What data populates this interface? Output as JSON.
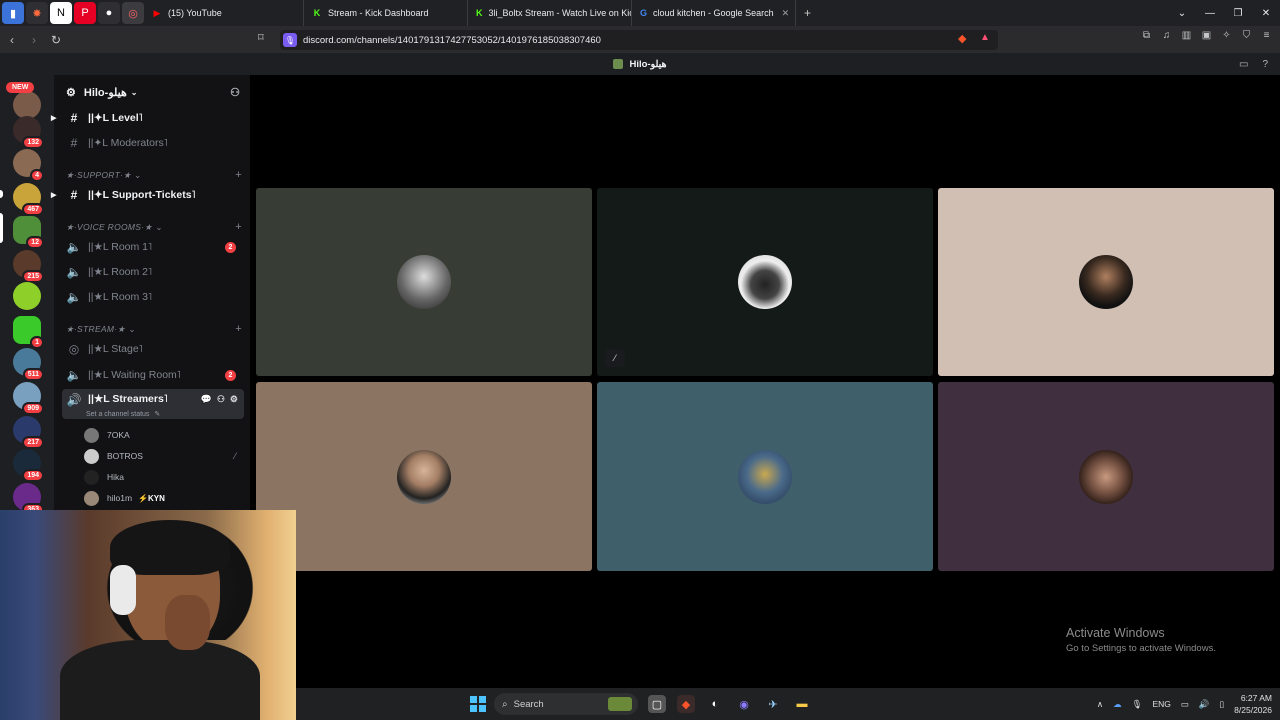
{
  "browser": {
    "tabs": [
      {
        "title": "(15) YouTube",
        "icon": "youtube-icon",
        "color": "#ff0000"
      },
      {
        "title": "Stream - Kick Dashboard",
        "icon": "kick-icon",
        "color": "#53fc18"
      },
      {
        "title": "3li_Boltx Stream - Watch Live on Kick",
        "icon": "kick-icon",
        "color": "#53fc18"
      },
      {
        "title": "cloud kitchen - Google Search",
        "icon": "google-icon",
        "color": "#4285f4"
      }
    ],
    "new_tab": "+",
    "url": "discord.com/channels/1401791317427753052/1401976185038307460"
  },
  "discord": {
    "title": "Hilo-هيلو",
    "server_name": "Hilo-هيلو",
    "new_label": "NEW",
    "server_badges": [
      "132",
      "4",
      "467",
      "12",
      "215",
      "1",
      "511",
      "909",
      "217",
      "194",
      "363"
    ],
    "channels": {
      "level": "||✦L Level˥",
      "moderators": "||✦L Moderators˥",
      "support_cat": "★·SUPPORT·★",
      "support_tickets": "||✦L Support-Tickets˥",
      "voice_cat": "★·VOICE ROOMS·★",
      "room1": "||★L Room 1˥",
      "room1_badge": "2",
      "room2": "||★L Room 2˥",
      "room3": "||★L Room 3˥",
      "stream_cat": "★·STREAM·★",
      "stage": "||★L Stage˥",
      "waiting": "||★L Waiting Room˥",
      "waiting_badge": "2",
      "streamers": "||★L Streamers˥",
      "status": "Set a channel status"
    },
    "members": [
      {
        "name": "7OKA",
        "tag": ""
      },
      {
        "name": "BOTROS",
        "tag": ""
      },
      {
        "name": "Hika",
        "tag": ""
      },
      {
        "name": "hilo1m",
        "tag": "⚡KYN"
      }
    ]
  },
  "activation": {
    "title": "Activate Windows",
    "subtitle": "Go to Settings to activate Windows."
  },
  "taskbar": {
    "search": "Search",
    "lang": "ENG",
    "time": "6:27 AM",
    "date": "8/25/2026"
  }
}
